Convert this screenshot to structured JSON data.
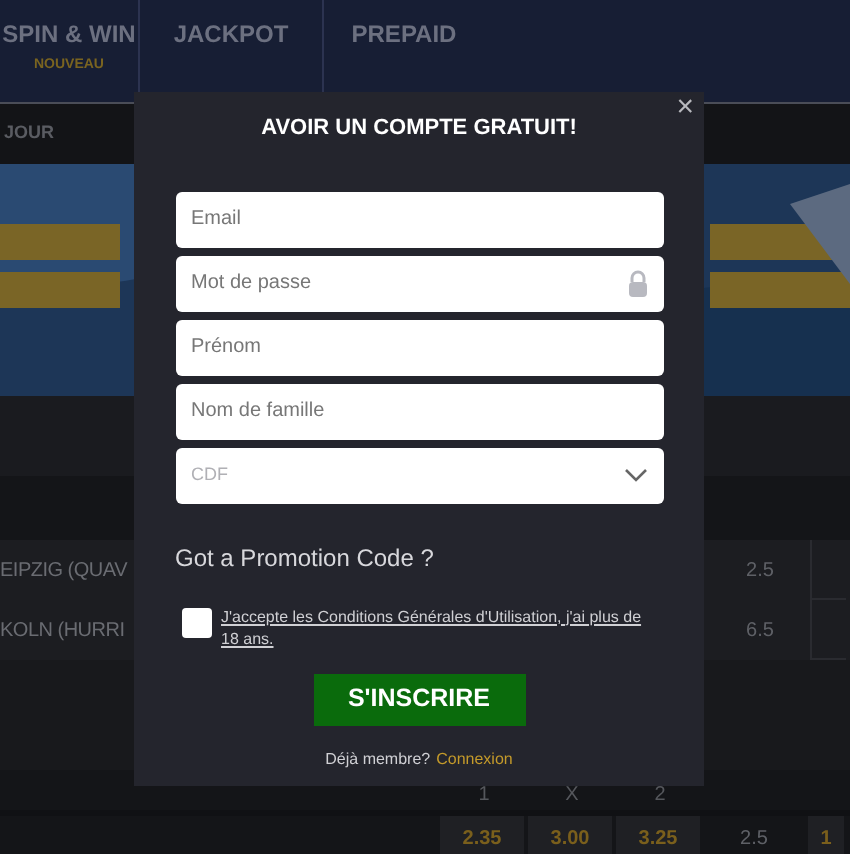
{
  "nav": {
    "tabs": [
      {
        "label": "SPIN & WIN",
        "badge": "NOUVEAU"
      },
      {
        "label": "JACKPOT"
      },
      {
        "label": "PREPAID"
      }
    ]
  },
  "subnav": {
    "label": "JOUR"
  },
  "odds_table": {
    "rows": [
      {
        "kind": "match",
        "team": "EIPZIG (QUAV",
        "line": "2.5"
      },
      {
        "kind": "match",
        "team": "KOLN (HURRI",
        "line": "6.5"
      },
      {
        "kind": "header",
        "cells": [
          "1",
          "X",
          "2"
        ]
      },
      {
        "kind": "odds",
        "odds": [
          "2.35",
          "3.00",
          "3.25"
        ],
        "line": "2.5",
        "column_6": "1"
      }
    ]
  },
  "modal": {
    "title": "AVOIR UN COMPTE GRATUIT!",
    "close": "×",
    "fields": [
      {
        "kind": "text",
        "placeholder": "Email"
      },
      {
        "kind": "password",
        "placeholder": "Mot de passe"
      },
      {
        "kind": "text",
        "placeholder": "Prénom"
      },
      {
        "kind": "text",
        "placeholder": "Nom de famille"
      },
      {
        "kind": "select",
        "value": "CDF"
      }
    ],
    "promo_link": "Got a Promotion Code ?",
    "terms": {
      "checked": false,
      "text": "J'accepte les Conditions Générales d'Utilisation, j'ai plus de 18 ans."
    },
    "submit": "S'INSCRIRE",
    "login_prompt": "Déjà membre?",
    "login_link": "Connexion"
  }
}
